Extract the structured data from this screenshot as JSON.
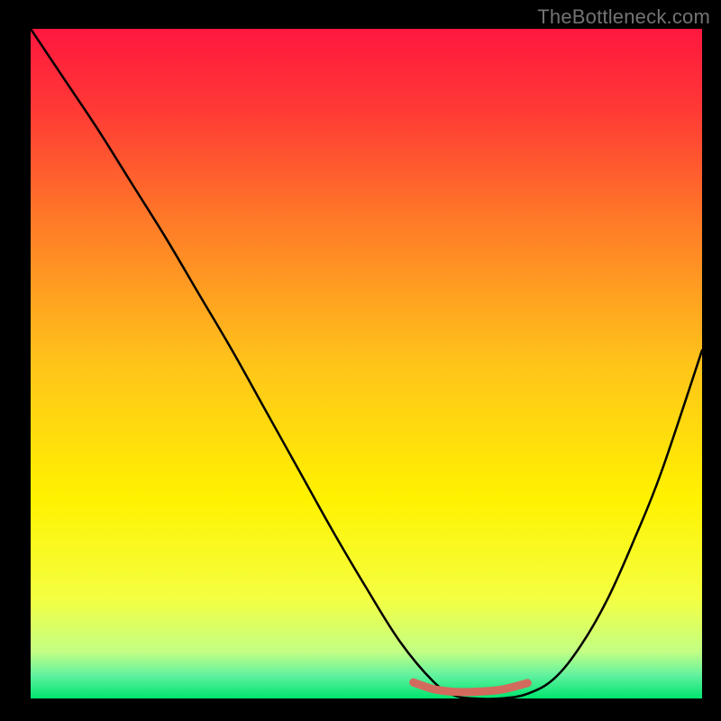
{
  "watermark": "TheBottleneck.com",
  "chart_data": {
    "type": "line",
    "title": "",
    "xlabel": "",
    "ylabel": "",
    "xlim": [
      0,
      100
    ],
    "ylim": [
      0,
      100
    ],
    "background_gradient": {
      "stops": [
        {
          "offset": 0.0,
          "color": "#ff173f"
        },
        {
          "offset": 0.12,
          "color": "#ff3935"
        },
        {
          "offset": 0.3,
          "color": "#ff7f27"
        },
        {
          "offset": 0.5,
          "color": "#ffc41a"
        },
        {
          "offset": 0.7,
          "color": "#fff200"
        },
        {
          "offset": 0.85,
          "color": "#f4ff41"
        },
        {
          "offset": 0.93,
          "color": "#c3ff84"
        },
        {
          "offset": 0.965,
          "color": "#62f29f"
        },
        {
          "offset": 1.0,
          "color": "#00e46f"
        }
      ]
    },
    "series": [
      {
        "name": "bottleneck-curve",
        "color": "#000000",
        "stroke_width": 2.5,
        "x": [
          0,
          5,
          10,
          15,
          20,
          25,
          30,
          35,
          40,
          45,
          50,
          55,
          60,
          63,
          66,
          70,
          74,
          78,
          82,
          86,
          90,
          94,
          100
        ],
        "values": [
          100,
          92.5,
          85,
          77,
          69,
          60.5,
          52,
          43,
          34,
          25,
          16.5,
          8.5,
          2.5,
          0.5,
          0.0,
          0.0,
          0.7,
          3.0,
          8.0,
          15,
          24,
          34,
          52
        ]
      },
      {
        "name": "sweet-spot-marker",
        "color": "#d36a5e",
        "stroke_width": 9,
        "x": [
          57,
          60,
          63,
          66,
          70,
          74
        ],
        "values": [
          2.4,
          1.4,
          1.0,
          1.0,
          1.3,
          2.3
        ]
      }
    ]
  }
}
